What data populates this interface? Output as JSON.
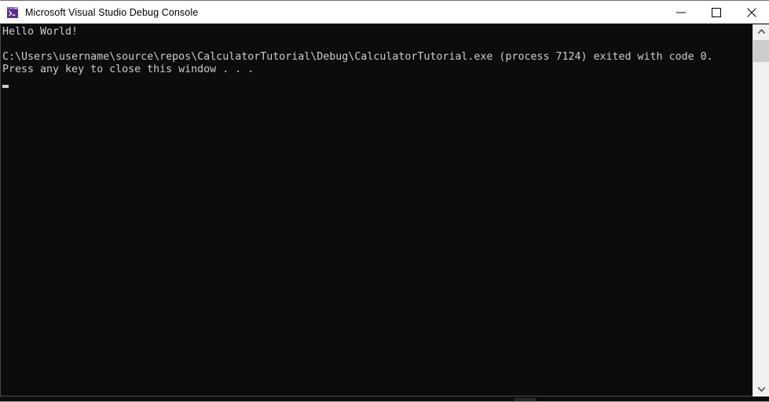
{
  "window": {
    "title": "Microsoft Visual Studio Debug Console",
    "icon": "console-app-icon",
    "colors": {
      "titlebar_bg": "#ffffff",
      "titlebar_text": "#000000",
      "console_bg": "#0c0c0c",
      "console_text": "#cccccc",
      "icon_purple": "#5c2d91",
      "scrollbar_track": "#f0f0f0",
      "scrollbar_thumb": "#cdcdcd",
      "close_hover": "#e81123"
    }
  },
  "titlebar": {
    "minimize_label": "Minimize",
    "maximize_label": "Maximize",
    "close_label": "Close",
    "minimize_icon": "minimize-icon",
    "maximize_icon": "maximize-icon",
    "close_icon": "close-icon"
  },
  "console": {
    "lines": [
      "Hello World!",
      "",
      "C:\\Users\\username\\source\\repos\\CalculatorTutorial\\Debug\\CalculatorTutorial.exe (process 7124) exited with code 0.",
      "Press any key to close this window . . ."
    ],
    "cursor_visible": true,
    "cursor_shape": "underscore-block"
  },
  "scrollbars": {
    "vertical": {
      "up_arrow_icon": "chevron-up-icon",
      "down_arrow_icon": "chevron-down-icon",
      "up_arrow_glyph": "⌃",
      "down_arrow_glyph": "⌄",
      "thumb_position": "top"
    },
    "horizontal": {
      "thumb_position": "center"
    }
  }
}
